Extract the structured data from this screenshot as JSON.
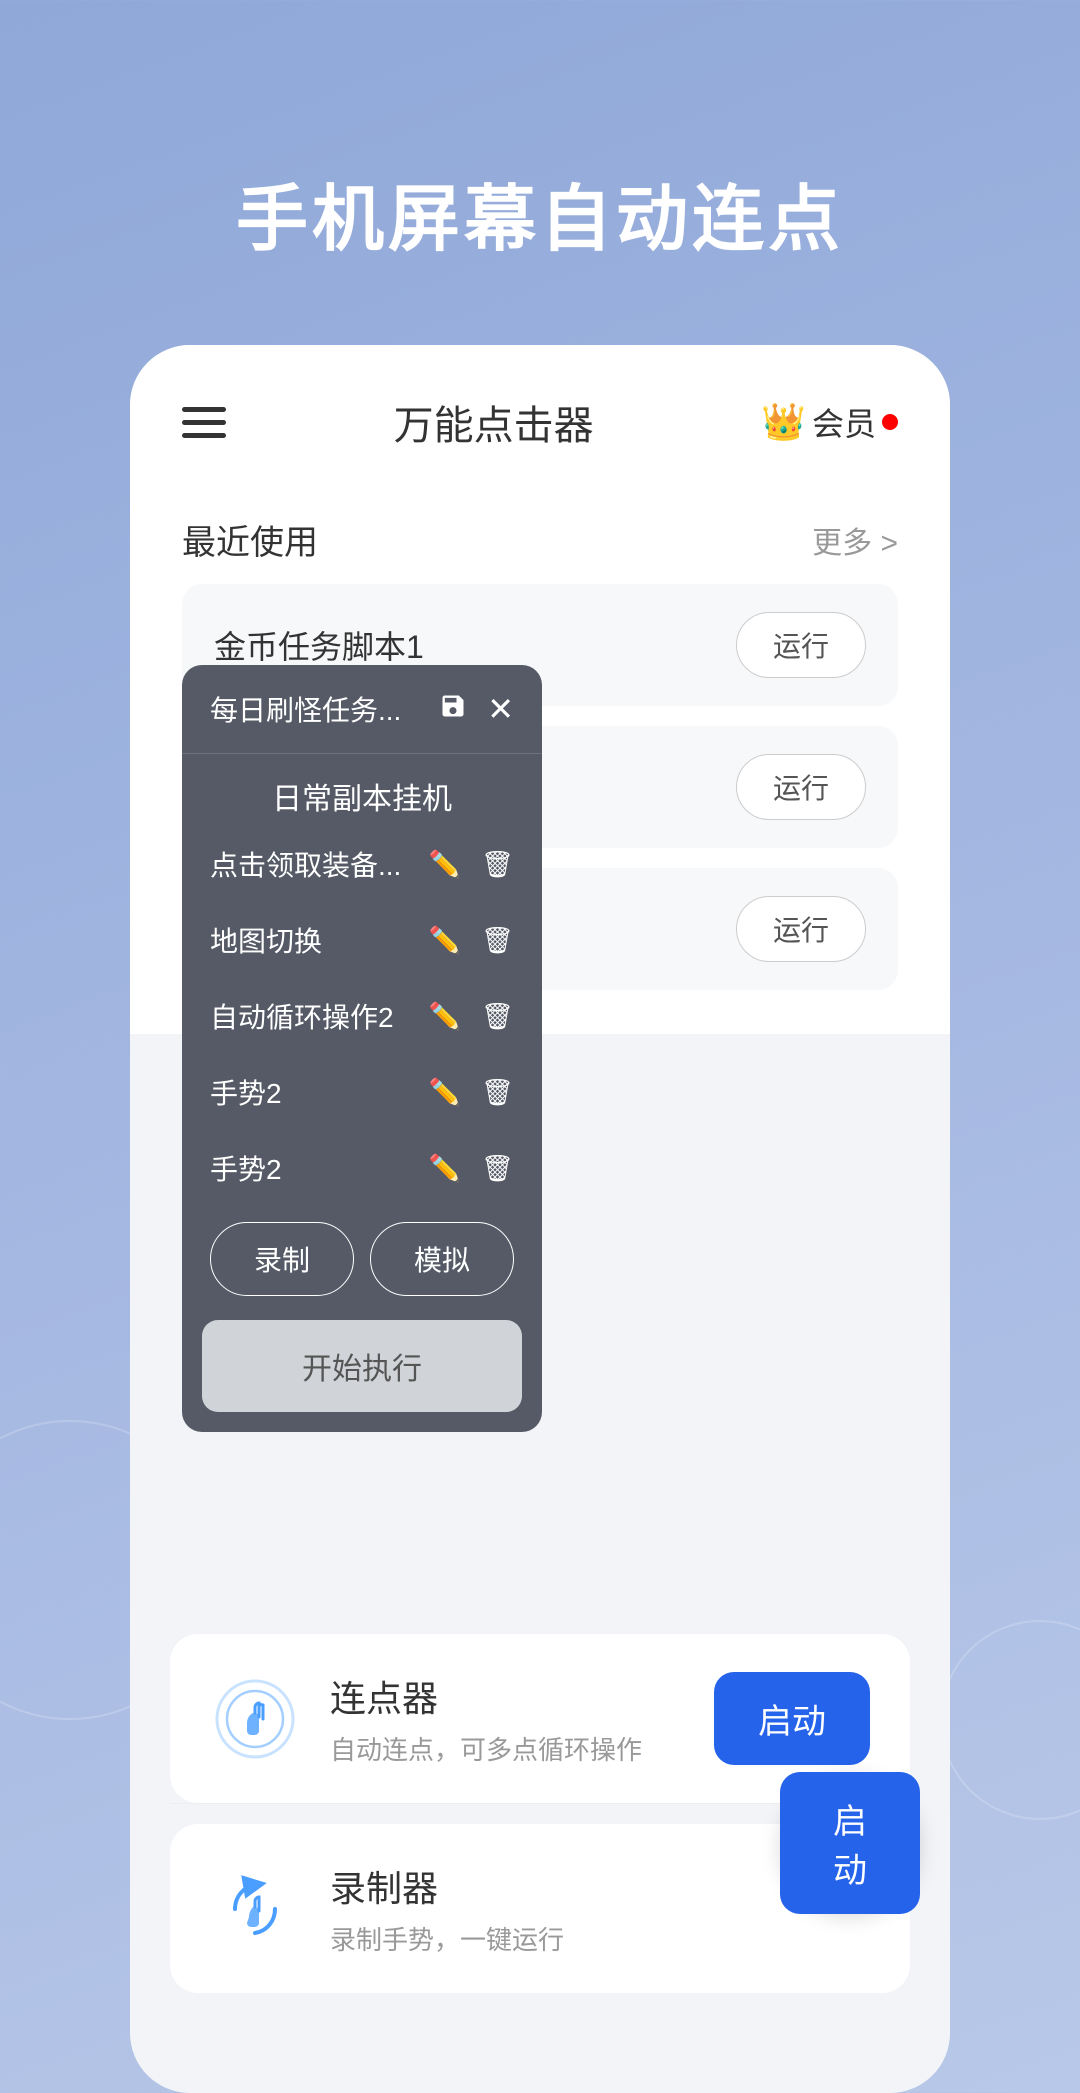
{
  "hero": {
    "title": "手机屏幕自动连点"
  },
  "header": {
    "title": "万能点击器",
    "membership_label": "会员"
  },
  "recent": {
    "label": "最近使用",
    "more_label": "更多 >"
  },
  "script_items": [
    {
      "id": 1,
      "name": "金币任务脚本1",
      "run_label": "运行"
    },
    {
      "id": 2,
      "name": "",
      "run_label": "运行"
    },
    {
      "id": 3,
      "name": "",
      "run_label": "运行"
    }
  ],
  "popup": {
    "header_title": "每日刷怪任务...",
    "main_label": "日常副本挂机",
    "rows": [
      {
        "name": "点击领取装备..."
      },
      {
        "name": "地图切换"
      },
      {
        "name": "自动循环操作2"
      },
      {
        "name": "手势2"
      },
      {
        "name": "手势2"
      }
    ],
    "record_label": "录制",
    "simulate_label": "模拟",
    "execute_label": "开始执行"
  },
  "features": [
    {
      "id": "clicker",
      "icon": "touch-icon",
      "name": "连点器",
      "desc": "自动连点，可多点循环操作",
      "start_label": "启动"
    },
    {
      "id": "recorder",
      "icon": "gesture-icon",
      "name": "录制器",
      "desc": "录制手势，一键运行",
      "start_label": "启动"
    }
  ],
  "colors": {
    "primary_blue": "#2563eb",
    "popup_bg": "#555a66",
    "background": "#a0b4e0"
  }
}
